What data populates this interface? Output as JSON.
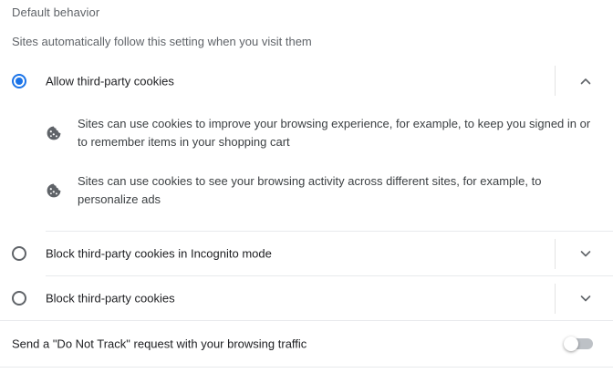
{
  "section": {
    "title": "Default behavior",
    "subtitle": "Sites automatically follow this setting when you visit them"
  },
  "options": [
    {
      "label": "Allow third-party cookies",
      "selected": true,
      "expanded": true,
      "details": [
        {
          "icon": "cookie-icon",
          "text": "Sites can use cookies to improve your browsing experience, for example, to keep you signed in or to remember items in your shopping cart"
        },
        {
          "icon": "cookie-icon",
          "text": "Sites can use cookies to see your browsing activity across different sites, for example, to personalize ads"
        }
      ]
    },
    {
      "label": "Block third-party cookies in Incognito mode",
      "selected": false,
      "expanded": false
    },
    {
      "label": "Block third-party cookies",
      "selected": false,
      "expanded": false
    }
  ],
  "do_not_track": {
    "label": "Send a \"Do Not Track\" request with your browsing traffic",
    "enabled": false
  },
  "colors": {
    "accent": "#1a73e8",
    "icon": "#5f6368",
    "separator": "#e8eaed"
  }
}
